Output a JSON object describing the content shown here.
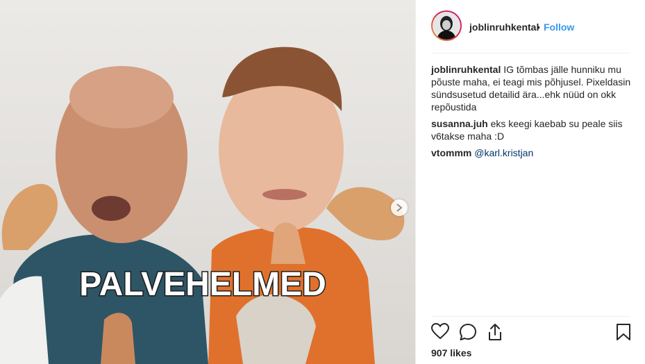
{
  "post": {
    "image_overlay_text": "PALVEHELMED"
  },
  "header": {
    "username": "joblinruhkental",
    "separator": "•",
    "follow_label": "Follow"
  },
  "comments": [
    {
      "user": "joblinruhkental",
      "text": "IG tõmbas jälle hunniku mu põuste maha, ei teagi mis põhjusel. Pixeldasin sündsusetud detailid ära...ehk nüüd on okk repõustida"
    },
    {
      "user": "susanna.juh",
      "text": "eks keegi kaebab su peale siis v6takse maha :D"
    },
    {
      "user": "vtommm",
      "text": "@karl.kristjan",
      "is_mention": true
    }
  ],
  "actions": {
    "icons": [
      "heart-icon",
      "comment-icon",
      "share-icon",
      "bookmark-icon"
    ]
  },
  "likes_label": "907 likes"
}
